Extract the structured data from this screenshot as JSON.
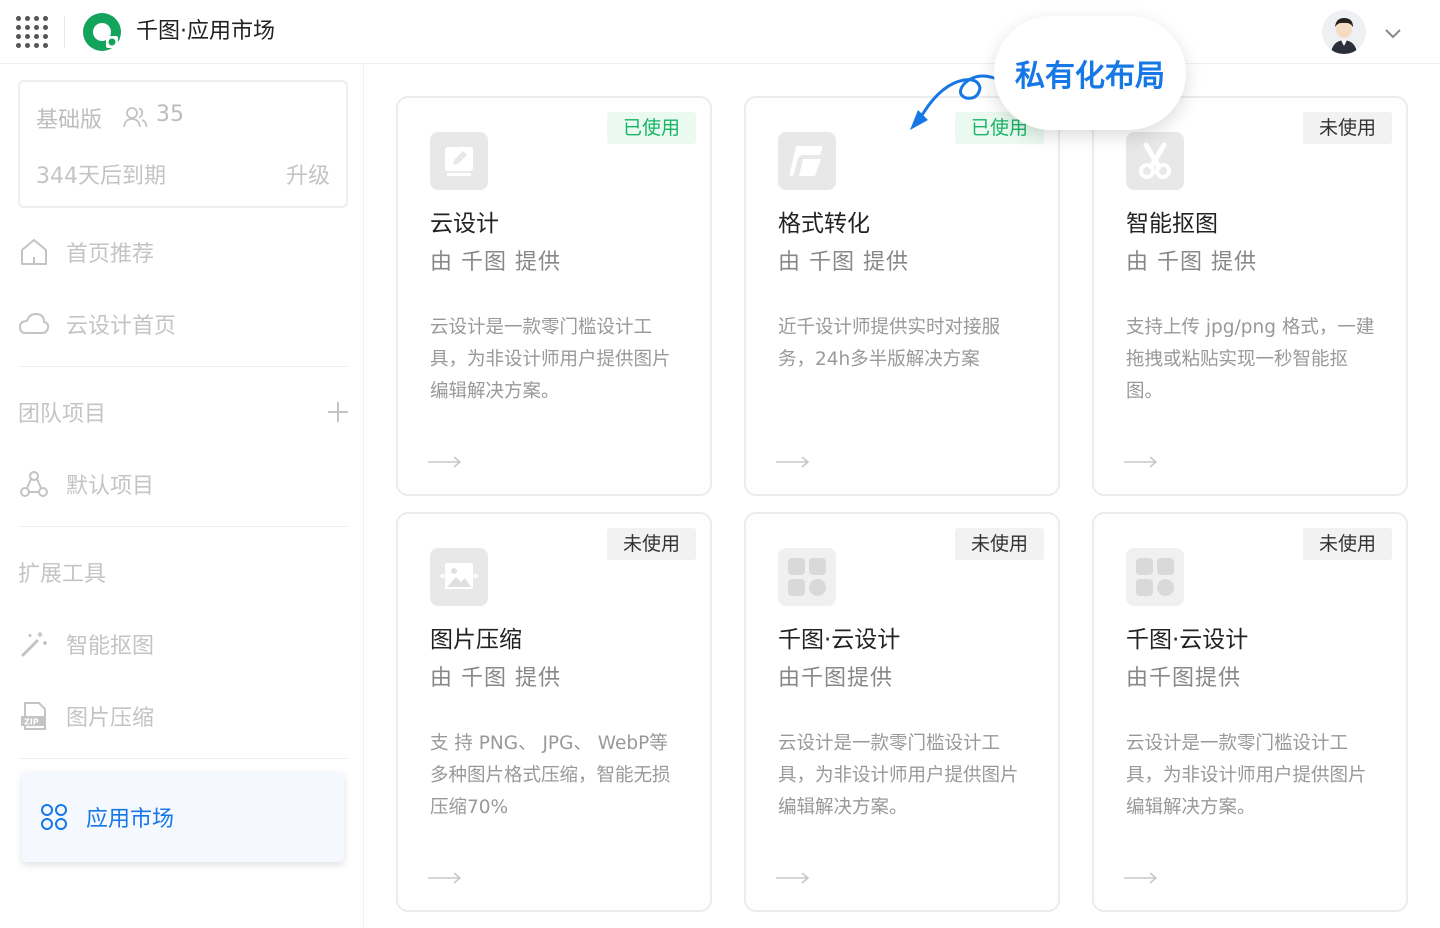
{
  "header": {
    "app_title": "千图·应用市场"
  },
  "sidebar": {
    "plan": {
      "name": "基础版",
      "member_count": "35",
      "expiry": "344天后到期",
      "upgrade": "升级"
    },
    "nav": {
      "home": "首页推荐",
      "cloud_home": "云设计首页"
    },
    "team_section": "团队项目",
    "default_project": "默认项目",
    "tools_section": "扩展工具",
    "tools": {
      "matting": "智能抠图",
      "compress": "图片压缩"
    },
    "market": "应用市场"
  },
  "callout": "私有化布局",
  "cards": [
    {
      "name": "云设计",
      "provider": "由 千图 提供",
      "status": "已使用",
      "desc": "云设计是一款零门槛设计工具，为非设计师用户提供图片编辑解决方案。"
    },
    {
      "name": "格式转化",
      "provider": "由 千图 提供",
      "status": "已使用",
      "desc": "近千设计师提供实时对接服务，24h多半版解决方案"
    },
    {
      "name": "智能抠图",
      "provider": "由 千图 提供",
      "status": "未使用",
      "desc": "支持上传 jpg/png 格式，一建拖拽或粘贴实现一秒智能抠图。"
    },
    {
      "name": "图片压缩",
      "provider": "由 千图 提供",
      "status": "未使用",
      "desc": "支 持 PNG、 JPG、 WebP等多种图片格式压缩，智能无损压缩70%"
    },
    {
      "name": "千图·云设计",
      "provider": "由千图提供",
      "status": "未使用",
      "desc": "云设计是一款零门槛设计工具，为非设计师用户提供图片编辑解决方案。"
    },
    {
      "name": "千图·云设计",
      "provider": "由千图提供",
      "status": "未使用",
      "desc": "云设计是一款零门槛设计工具，为非设计师用户提供图片编辑解决方案。"
    }
  ],
  "colors": {
    "accent": "#1677e6",
    "used_text": "#17b565",
    "used_bg": "#eafaf0",
    "unused_bg": "#f2f2f2"
  }
}
